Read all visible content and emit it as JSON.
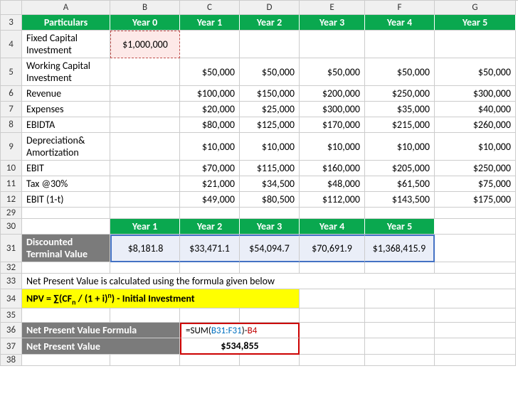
{
  "cols": [
    "A",
    "B",
    "C",
    "D",
    "E",
    "F",
    "G"
  ],
  "headers": {
    "particulars": "Particulars",
    "years": [
      "Year 0",
      "Year 1",
      "Year 2",
      "Year 3",
      "Year 4",
      "Year 5"
    ]
  },
  "rows": {
    "3": 3,
    "4": 4,
    "5": 5,
    "6": 6,
    "7": 7,
    "8": 8,
    "9": 9,
    "10": 10,
    "11": 11,
    "12": 12,
    "29": 29,
    "30": 30,
    "31": 31,
    "32": 32,
    "33": 33,
    "34": 34,
    "35": 35,
    "36": 36,
    "37": 37,
    "38": 38
  },
  "labels": {
    "fixed_capital": "Fixed Capital Investment",
    "working_capital": "Working Capital Investment",
    "revenue": "Revenue",
    "expenses": "Expenses",
    "ebidta": "EBIDTA",
    "dep_amort": "Depreciation& Amortization",
    "ebit": "EBIT",
    "tax": "Tax @30%",
    "ebit_1t": "EBIT (1-t)",
    "discounted_terminal": "Discounted Terminal Value",
    "npv_formula_label": "Net Present Value Formula",
    "npv_label": "Net Present Value"
  },
  "values": {
    "fixed_capital": "$1,000,000",
    "working_capital": [
      "$50,000",
      "$50,000",
      "$50,000",
      "$50,000",
      "$50,000"
    ],
    "revenue": [
      "$100,000",
      "$150,000",
      "$200,000",
      "$250,000",
      "$300,000"
    ],
    "expenses": [
      "$20,000",
      "$25,000",
      "$300,000",
      "$35,000",
      "$40,000"
    ],
    "ebidta": [
      "$80,000",
      "$125,000",
      "$170,000",
      "$215,000",
      "$260,000"
    ],
    "dep_amort": [
      "$10,000",
      "$10,000",
      "$10,000",
      "$10,000",
      "$10,000"
    ],
    "ebit": [
      "$70,000",
      "$115,000",
      "$160,000",
      "$205,000",
      "$250,000"
    ],
    "tax": [
      "$21,000",
      "$34,500",
      "$48,000",
      "$61,500",
      "$75,000"
    ],
    "ebit_1t": [
      "$49,000",
      "$80,500",
      "$112,000",
      "$143,500",
      "$175,000"
    ]
  },
  "second_table": {
    "headers": [
      "Year 1",
      "Year 2",
      "Year 3",
      "Year 4",
      "Year 5"
    ],
    "values": [
      "$8,181.8",
      "$33,471.1",
      "$54,094.7",
      "$70,691.9",
      "$1,368,415.9"
    ]
  },
  "text": {
    "explain": "Net Present Value is calculated using the formula given below",
    "npv_eq_1": "NPV = ∑(CF",
    "npv_eq_sub": "n",
    "npv_eq_2": " / (1 + i)",
    "npv_eq_sup": "n",
    "npv_eq_3": ") - Initial Investment"
  },
  "formula": {
    "eq": "=",
    "sum": "SUM(",
    "range": "B31:F31",
    "close": ")-",
    "ref": "B4"
  },
  "result": "$534,855",
  "chart_data": {
    "type": "table",
    "title": "NPV Calculation Spreadsheet",
    "main_table": {
      "columns": [
        "Particulars",
        "Year 0",
        "Year 1",
        "Year 2",
        "Year 3",
        "Year 4",
        "Year 5"
      ],
      "rows": [
        [
          "Fixed Capital Investment",
          1000000,
          null,
          null,
          null,
          null,
          null
        ],
        [
          "Working Capital Investment",
          null,
          50000,
          50000,
          50000,
          50000,
          50000
        ],
        [
          "Revenue",
          null,
          100000,
          150000,
          200000,
          250000,
          300000
        ],
        [
          "Expenses",
          null,
          20000,
          25000,
          300000,
          35000,
          40000
        ],
        [
          "EBIDTA",
          null,
          80000,
          125000,
          170000,
          215000,
          260000
        ],
        [
          "Depreciation& Amortization",
          null,
          10000,
          10000,
          10000,
          10000,
          10000
        ],
        [
          "EBIT",
          null,
          70000,
          115000,
          160000,
          205000,
          250000
        ],
        [
          "Tax @30%",
          null,
          21000,
          34500,
          48000,
          61500,
          75000
        ],
        [
          "EBIT (1-t)",
          null,
          49000,
          80500,
          112000,
          143500,
          175000
        ]
      ]
    },
    "discounted_terminal_value": {
      "columns": [
        "Year 1",
        "Year 2",
        "Year 3",
        "Year 4",
        "Year 5"
      ],
      "values": [
        8181.8,
        33471.1,
        54094.7,
        70691.9,
        1368415.9
      ]
    },
    "formula_text": "NPV = ∑(CFn / (1 + i)^n) - Initial Investment",
    "npv_cell_formula": "=SUM(B31:F31)-B4",
    "npv_result": 534855
  }
}
